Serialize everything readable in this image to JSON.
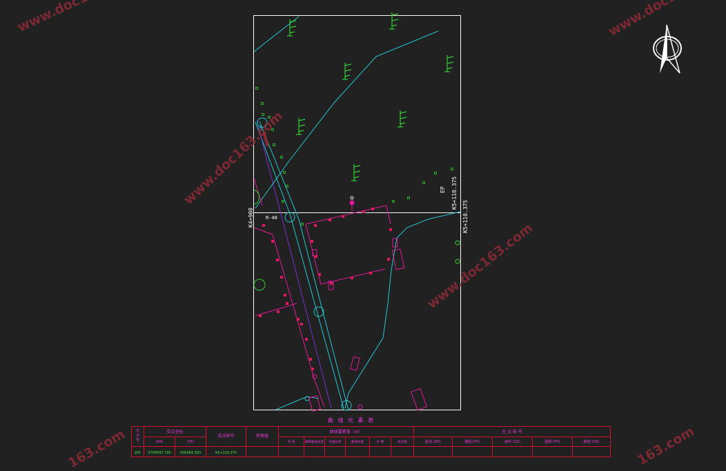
{
  "labels": {
    "station_left": "K4+900",
    "station_right": "K5+110.375",
    "station_right_top": "K5+110.375",
    "ep": "EP",
    "radius": "R-40"
  },
  "table": {
    "title": "曲 线 元 素 表",
    "col_point_no": "交点号",
    "col_coord_group": "交点坐标",
    "col_x": "X(N)",
    "col_y": "Y(E)",
    "col_station": "交点桩号",
    "col_angle": "转角值",
    "col_curve_group": "曲线要素值（m）",
    "curve_subcols": [
      "半 径",
      "缓和曲线长度",
      "切线长度",
      "曲线长度",
      "外 距",
      "校正值"
    ],
    "col_main_group": "主 点 桩 号",
    "main_subcols": [
      "起点(ZH)",
      "第一缓和曲线终点(HY)",
      "曲中(QZ)",
      "第二缓和曲线起点(YH)",
      "终点(HZ)"
    ],
    "main_subcols_short": [
      "起点 (ZH)",
      "缓圆 (HY)",
      "曲中 (QZ)",
      "圆缓 (YH)",
      "缓直 (HZ)"
    ],
    "row": {
      "point": "JD5",
      "x": "3794597.790",
      "y": "506364.383",
      "station": "K5+110.375"
    }
  },
  "watermarks": [
    "www.doc163.com",
    "www.doc163.com",
    "www.doc163.com",
    "www.doc163.com",
    "163.com",
    "163.com"
  ],
  "colors": {
    "background": "#212121",
    "frame": "#ffffff",
    "road": "#22c9d1",
    "tree": "#2fd02f",
    "building": "#e0199a",
    "building_point": "#e0185c",
    "table_border": "#d0102c",
    "table_text": "#e838d8",
    "value_text": "#3cf03c",
    "watermark": "#8a2a35"
  },
  "icons": [
    "north-arrow-icon"
  ]
}
